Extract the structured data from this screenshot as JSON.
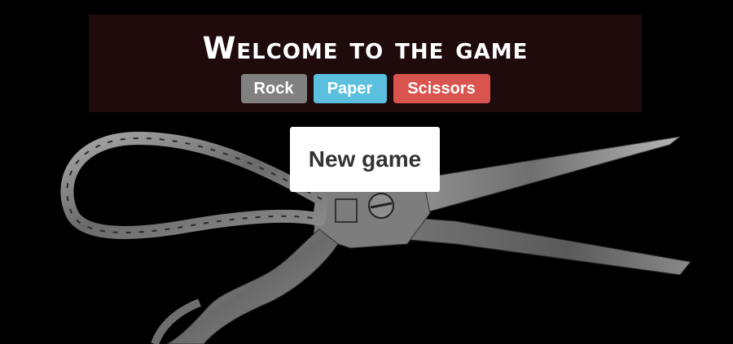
{
  "header": {
    "title": "Welcome to the game"
  },
  "choices": [
    {
      "label": "Rock",
      "color": "#808080"
    },
    {
      "label": "Paper",
      "color": "#5bc0de"
    },
    {
      "label": "Scissors",
      "color": "#d9534f"
    }
  ],
  "actions": {
    "new_game_label": "New game"
  },
  "background": {
    "image": "scissors-photo",
    "color": "#000000"
  }
}
